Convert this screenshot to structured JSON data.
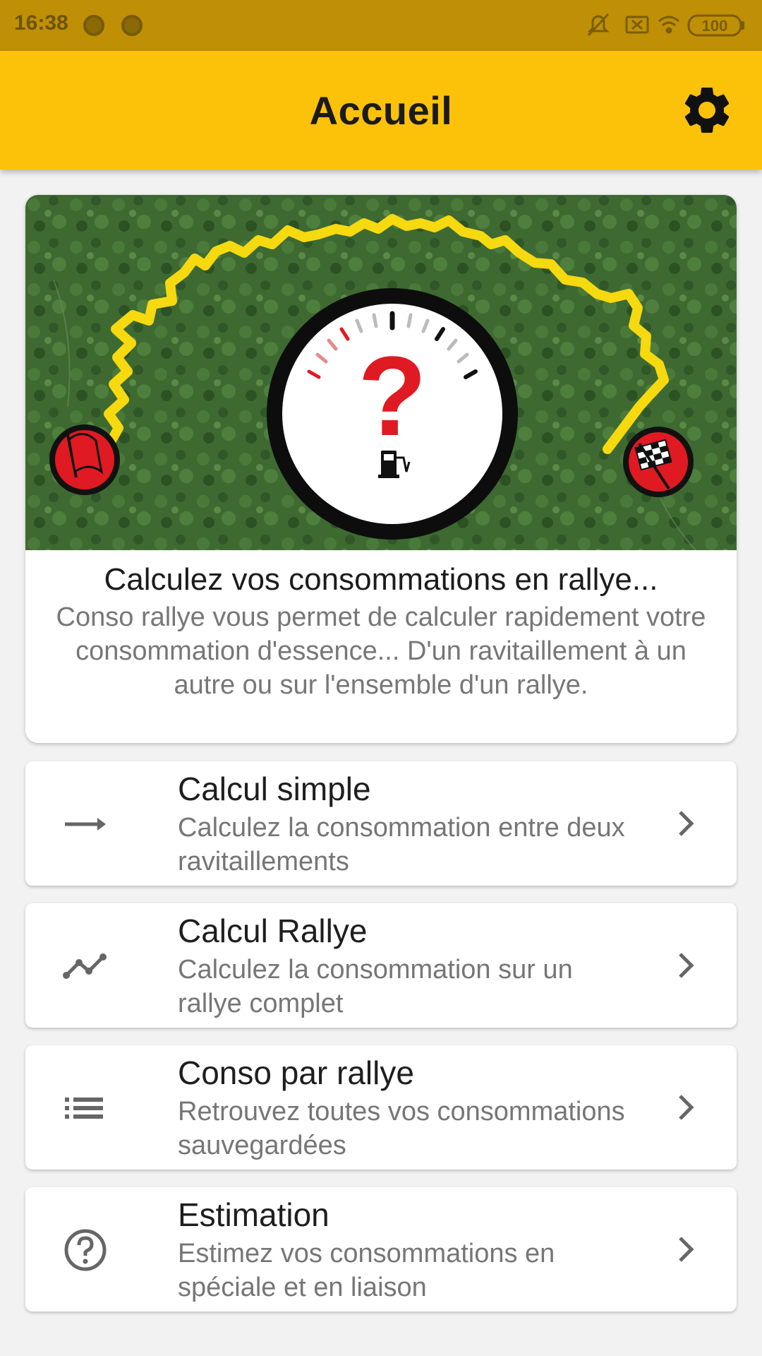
{
  "status": {
    "time": "16:38",
    "battery": "100"
  },
  "header": {
    "title": "Accueil",
    "settings_icon": "gear-icon"
  },
  "hero": {
    "title": "Calculez vos consommations en rallye...",
    "description": "Conso rallye vous permet de calculer rapidement votre consommation d'essence... D'un ravitaillement à un autre ou sur l'ensemble d'un rallye.",
    "image_icons": [
      "start-flag-icon",
      "fuel-gauge-question-icon",
      "checkered-flag-icon"
    ]
  },
  "menu": [
    {
      "icon": "arrow-right-icon",
      "title": "Calcul simple",
      "subtitle": "Calculez la consommation entre deux ravitaillements"
    },
    {
      "icon": "line-chart-icon",
      "title": "Calcul Rallye",
      "subtitle": "Calculez la consommation sur un rallye complet"
    },
    {
      "icon": "list-icon",
      "title": "Conso par rallye",
      "subtitle": "Retrouvez toutes vos consommations sauvegardées"
    },
    {
      "icon": "help-circle-icon",
      "title": "Estimation",
      "subtitle": "Estimez vos consommations en spéciale et en liaison"
    }
  ],
  "colors": {
    "app_bar": "#fcc109",
    "status_bar": "#bf8f05",
    "route": "#f6d90f",
    "gauge_red": "#e01a22"
  }
}
